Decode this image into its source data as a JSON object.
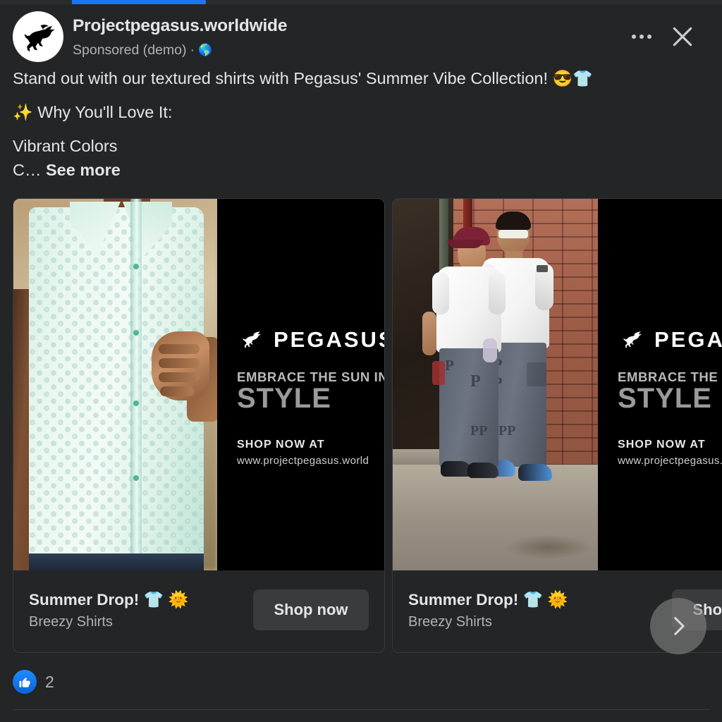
{
  "progress": {
    "percent": 19
  },
  "header": {
    "page_name": "Projectpegasus.worldwide",
    "sponsored_label": "Sponsored (demo)",
    "separator": "·",
    "globe_icon": "globe-icon",
    "menu_icon": "more-options-icon",
    "close_icon": "close-icon",
    "avatar_icon": "pegasus-logo-avatar"
  },
  "post": {
    "line1": "Stand out with our textured shirts with Pegasus' Summer Vibe Collection!",
    "line1_emoji1": "😎",
    "line1_emoji2": "👕",
    "line2_emoji": "✨",
    "line2": " Why You'll Love It:",
    "line3": "Vibrant Colors",
    "line4_truncated": "C… ",
    "see_more": "See more"
  },
  "carousel": {
    "next_icon": "chevron-right-icon",
    "cards": [
      {
        "image_alt": "man-in-mint-textured-shirt",
        "brand": {
          "logo_icon": "pegasus-logo-icon",
          "wordmark": "PEGASUS",
          "tagline_top": "EMBRACE THE SUN IN",
          "tagline_bottom": "STYLE",
          "shop_label": "SHOP NOW AT",
          "url": "www.projectpegasus.world"
        },
        "title": "Summer Drop! 👕 🌞",
        "title_text": "Summer Drop!",
        "title_emoji1": "👕",
        "title_emoji2": "🌞",
        "subtitle": "Breezy Shirts",
        "cta_label": "Shop now"
      },
      {
        "image_alt": "two-models-streetwear-brick-wall",
        "brand": {
          "logo_icon": "pegasus-logo-icon",
          "wordmark": "PEGASUS",
          "tagline_top": "EMBRACE THE SUN IN",
          "tagline_bottom": "STYLE",
          "shop_label": "SHOP NOW AT",
          "url": "www.projectpegasus.world"
        },
        "title": "Summer Drop! 👕 🌞",
        "title_text": "Summer Drop!",
        "title_emoji1": "👕",
        "title_emoji2": "🌞",
        "subtitle": "Breezy Shirts",
        "cta_label": "Shop now"
      }
    ]
  },
  "reactions": {
    "like_icon": "thumbs-up-icon",
    "count": "2"
  },
  "colors": {
    "background": "#242526",
    "surface": "#242526",
    "accent_blue": "#1877f2",
    "button": "#3a3b3c",
    "text_primary": "#e4e6eb",
    "text_secondary": "#b0b3b8",
    "brand_black": "#000000",
    "shirt_mint": "#dff2ea"
  }
}
